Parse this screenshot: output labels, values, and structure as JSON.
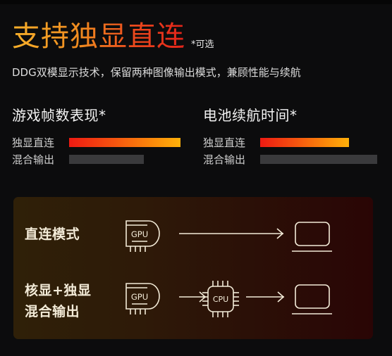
{
  "header": {
    "title": "支持独显直连",
    "optional_note": "*可选",
    "subtitle": "DDG双模显示技术，保留两种图像输出模式，兼顾性能与续航"
  },
  "metrics": [
    {
      "title": "游戏帧数表现*",
      "bars": [
        {
          "label": "独显直连",
          "value": 0.95,
          "style": "highlight"
        },
        {
          "label": "混合输出",
          "value": 0.64,
          "style": "muted"
        }
      ]
    },
    {
      "title": "电池续航时间*",
      "bars": [
        {
          "label": "独显直连",
          "value": 0.76,
          "style": "highlight"
        },
        {
          "label": "混合输出",
          "value": 1.0,
          "style": "muted"
        }
      ]
    }
  ],
  "modes": {
    "direct": {
      "label": "直连模式",
      "flow": [
        "gpu-icon",
        "arrow-right-icon",
        "laptop-icon"
      ],
      "gpu_text": "GPU"
    },
    "hybrid": {
      "label_line1": "核显+独显",
      "label_line2": "混合输出",
      "flow": [
        "gpu-icon",
        "arrow-right-icon",
        "cpu-icon",
        "arrow-right-icon",
        "laptop-icon"
      ],
      "gpu_text": "GPU",
      "cpu_text": "CPU"
    }
  },
  "colors": {
    "background": "#0c0c0d",
    "title_gradient_start": "#f7b02a",
    "title_gradient_end": "#e2231a",
    "bar_highlight_start": "#ee1a12",
    "bar_highlight_end": "#ffb10a",
    "bar_muted": "#3a3a3c",
    "card_left": "#2f2008",
    "card_right": "#2a0505",
    "icon_stroke": "#f3ebd8"
  }
}
